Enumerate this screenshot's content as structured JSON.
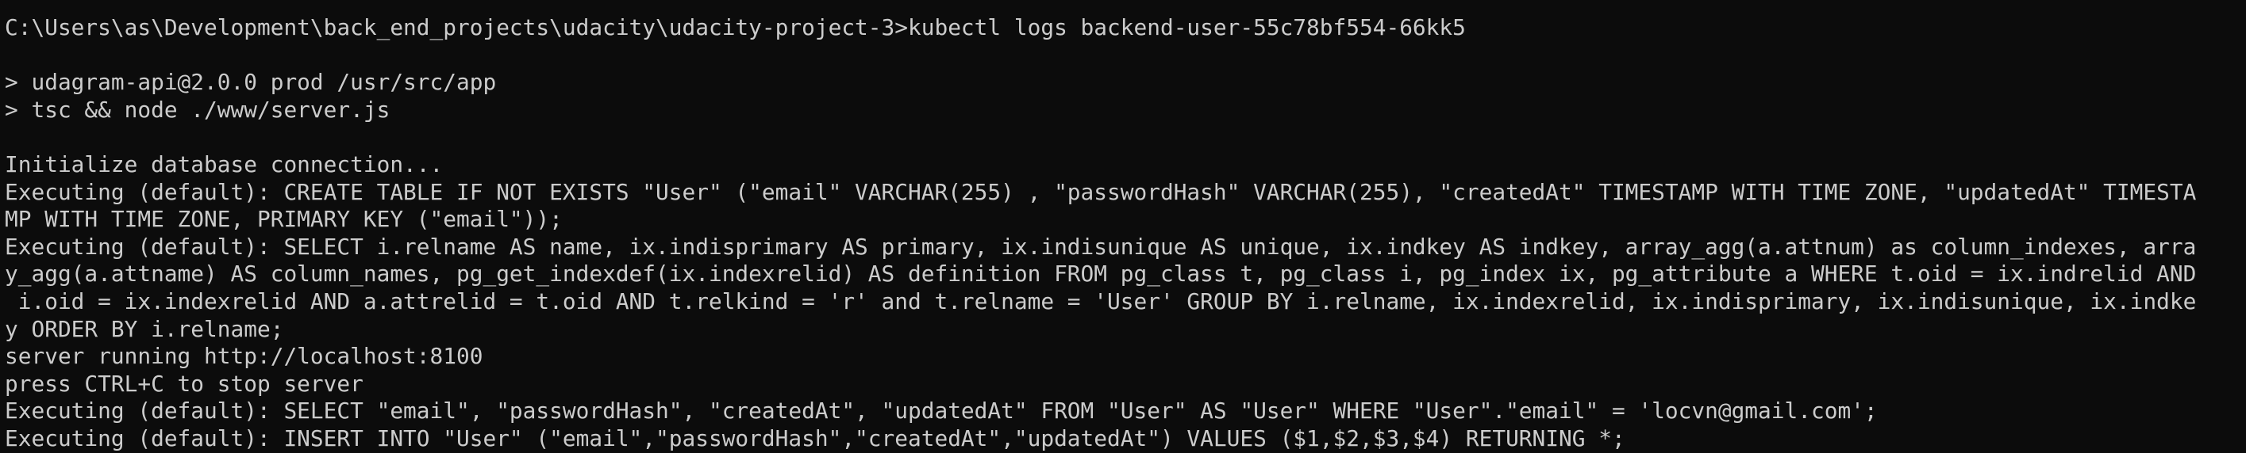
{
  "terminal": {
    "lines": [
      "C:\\Users\\as\\Development\\back_end_projects\\udacity\\udacity-project-3>kubectl logs backend-user-55c78bf554-66kk5",
      "",
      "> udagram-api@2.0.0 prod /usr/src/app",
      "> tsc && node ./www/server.js",
      "",
      "Initialize database connection...",
      "Executing (default): CREATE TABLE IF NOT EXISTS \"User\" (\"email\" VARCHAR(255) , \"passwordHash\" VARCHAR(255), \"createdAt\" TIMESTAMP WITH TIME ZONE, \"updatedAt\" TIMESTA",
      "MP WITH TIME ZONE, PRIMARY KEY (\"email\"));",
      "Executing (default): SELECT i.relname AS name, ix.indisprimary AS primary, ix.indisunique AS unique, ix.indkey AS indkey, array_agg(a.attnum) as column_indexes, arra",
      "y_agg(a.attname) AS column_names, pg_get_indexdef(ix.indexrelid) AS definition FROM pg_class t, pg_class i, pg_index ix, pg_attribute a WHERE t.oid = ix.indrelid AND",
      " i.oid = ix.indexrelid AND a.attrelid = t.oid AND t.relkind = 'r' and t.relname = 'User' GROUP BY i.relname, ix.indexrelid, ix.indisprimary, ix.indisunique, ix.indke",
      "y ORDER BY i.relname;",
      "server running http://localhost:8100",
      "press CTRL+C to stop server",
      "Executing (default): SELECT \"email\", \"passwordHash\", \"createdAt\", \"updatedAt\" FROM \"User\" AS \"User\" WHERE \"User\".\"email\" = 'locvn@gmail.com';",
      "Executing (default): INSERT INTO \"User\" (\"email\",\"passwordHash\",\"createdAt\",\"updatedAt\") VALUES ($1,$2,$3,$4) RETURNING *;"
    ]
  }
}
